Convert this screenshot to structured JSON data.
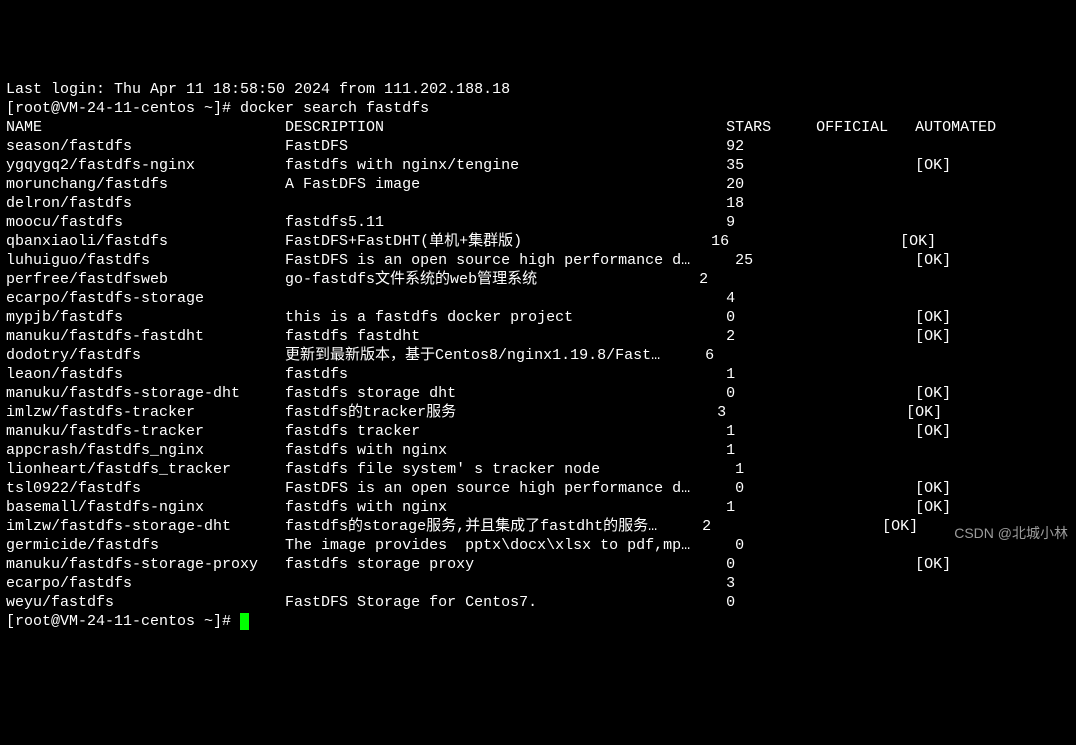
{
  "lines": {
    "login": "Last login: Thu Apr 11 18:58:50 2024 from 111.202.188.18",
    "prompt1": "[root@VM-24-11-centos ~]# docker search fastdfs",
    "prompt2": "[root@VM-24-11-centos ~]# "
  },
  "headers": {
    "name": "NAME",
    "description": "DESCRIPTION",
    "stars": "STARS",
    "official": "OFFICIAL",
    "automated": "AUTOMATED"
  },
  "rows": [
    {
      "name": "season/fastdfs",
      "description": "FastDFS",
      "stars": "92",
      "automated": "",
      "stars_offset": 0
    },
    {
      "name": "ygqygq2/fastdfs-nginx",
      "description": "fastdfs with nginx/tengine",
      "stars": "35",
      "automated": "[OK]",
      "stars_offset": 0
    },
    {
      "name": "morunchang/fastdfs",
      "description": "A FastDFS image",
      "stars": "20",
      "automated": "",
      "stars_offset": 0
    },
    {
      "name": "delron/fastdfs",
      "description": "",
      "stars": "18",
      "automated": "",
      "stars_offset": 0
    },
    {
      "name": "moocu/fastdfs",
      "description": "fastdfs5.11",
      "stars": "9",
      "automated": "",
      "stars_offset": 0
    },
    {
      "name": "qbanxiaoli/fastdfs",
      "description": "FastDFS+FastDHT(单机+集群版)",
      "stars": "16",
      "automated": "[OK]",
      "stars_offset": 0
    },
    {
      "name": "luhuiguo/fastdfs",
      "description": "FastDFS is an open source high performance d…",
      "stars": "25",
      "automated": "[OK]",
      "stars_offset": 1
    },
    {
      "name": "perfree/fastdfsweb",
      "description": "go-fastdfs文件系统的web管理系统",
      "stars": "2",
      "automated": "",
      "stars_offset": 0
    },
    {
      "name": "ecarpo/fastdfs-storage",
      "description": "",
      "stars": "4",
      "automated": "",
      "stars_offset": 0
    },
    {
      "name": "mypjb/fastdfs",
      "description": "this is a fastdfs docker project",
      "stars": "0",
      "automated": "[OK]",
      "stars_offset": 0
    },
    {
      "name": "manuku/fastdfs-fastdht",
      "description": "fastdfs fastdht",
      "stars": "2",
      "automated": "[OK]",
      "stars_offset": 0
    },
    {
      "name": "dodotry/fastdfs",
      "description": "更新到最新版本，基于Centos8/nginx1.19.8/Fast…",
      "stars": "6",
      "automated": "",
      "stars_offset": 1
    },
    {
      "name": "leaon/fastdfs",
      "description": "fastdfs",
      "stars": "1",
      "automated": "",
      "stars_offset": 0
    },
    {
      "name": "manuku/fastdfs-storage-dht",
      "description": "fastdfs storage dht",
      "stars": "0",
      "automated": "[OK]",
      "stars_offset": 0
    },
    {
      "name": "imlzw/fastdfs-tracker",
      "description": "fastdfs的tracker服务",
      "stars": "3",
      "automated": "[OK]",
      "stars_offset": 0
    },
    {
      "name": "manuku/fastdfs-tracker",
      "description": "fastdfs tracker",
      "stars": "1",
      "automated": "[OK]",
      "stars_offset": 0
    },
    {
      "name": "appcrash/fastdfs_nginx",
      "description": "fastdfs with nginx",
      "stars": "1",
      "automated": "",
      "stars_offset": 0
    },
    {
      "name": "lionheart/fastdfs_tracker",
      "description": "fastdfs file system' s tracker node",
      "stars": "1",
      "automated": "",
      "stars_offset": 1
    },
    {
      "name": "tsl0922/fastdfs",
      "description": "FastDFS is an open source high performance d…",
      "stars": "0",
      "automated": "[OK]",
      "stars_offset": 1
    },
    {
      "name": "basemall/fastdfs-nginx",
      "description": "fastdfs with nginx",
      "stars": "1",
      "automated": "[OK]",
      "stars_offset": 0
    },
    {
      "name": "imlzw/fastdfs-storage-dht",
      "description": "fastdfs的storage服务,并且集成了fastdht的服务…",
      "stars": "2",
      "automated": "[OK]",
      "stars_offset": 1
    },
    {
      "name": "germicide/fastdfs",
      "description": "The image provides  pptx\\docx\\xlsx to pdf,mp…",
      "stars": "0",
      "automated": "",
      "stars_offset": 1
    },
    {
      "name": "manuku/fastdfs-storage-proxy",
      "description": "fastdfs storage proxy",
      "stars": "0",
      "automated": "[OK]",
      "stars_offset": 0
    },
    {
      "name": "ecarpo/fastdfs",
      "description": "",
      "stars": "3",
      "automated": "",
      "stars_offset": 0
    },
    {
      "name": "weyu/fastdfs",
      "description": "FastDFS Storage for Centos7.",
      "stars": "0",
      "automated": "",
      "stars_offset": 0
    }
  ],
  "layout": {
    "col_name": 0,
    "col_desc": 31,
    "col_stars": 80,
    "col_official": 90,
    "col_automated": 101
  },
  "watermark": "CSDN @北城小林"
}
